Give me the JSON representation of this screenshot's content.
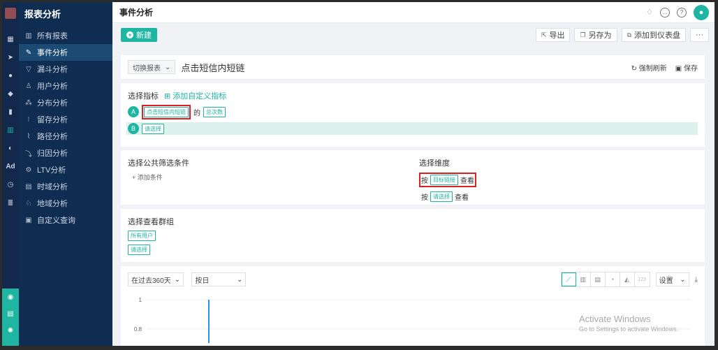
{
  "sidebar": {
    "header": "报表分析",
    "items": [
      {
        "label": "所有报表",
        "icon": "bar-chart-icon",
        "active": false
      },
      {
        "label": "事件分析",
        "icon": "edit-icon",
        "active": true
      },
      {
        "label": "漏斗分析",
        "icon": "funnel-icon",
        "active": false
      },
      {
        "label": "用户分析",
        "icon": "user-icon",
        "active": false
      },
      {
        "label": "分布分析",
        "icon": "distribution-icon",
        "active": false
      },
      {
        "label": "留存分析",
        "icon": "retention-icon",
        "active": false
      },
      {
        "label": "路径分析",
        "icon": "path-icon",
        "active": false
      },
      {
        "label": "归因分析",
        "icon": "attribution-icon",
        "active": false
      },
      {
        "label": "LTV分析",
        "icon": "ltv-icon",
        "active": false
      },
      {
        "label": "时域分析",
        "icon": "time-icon",
        "active": false
      },
      {
        "label": "地域分析",
        "icon": "region-icon",
        "active": false
      },
      {
        "label": "自定义查询",
        "icon": "query-icon",
        "active": false
      }
    ]
  },
  "rail": {
    "ad_label": "Ad"
  },
  "topbar": {
    "title": "事件分析",
    "avatar_icon": "user-icon"
  },
  "actions": {
    "new_label": "新建",
    "export_label": "导出",
    "save_as_label": "另存为",
    "add_dashboard_label": "添加到仪表盘",
    "more_label": "···"
  },
  "report": {
    "switch_label": "切换报表",
    "name": "点击短信内短链",
    "refresh_label": "强制刷新",
    "save_label": "保存"
  },
  "metrics": {
    "title": "选择指标",
    "add_custom_label": "添加自定义指标",
    "rows": [
      {
        "badge": "A",
        "event": "点击短信内短链",
        "joiner": "的",
        "measure": "总次数"
      },
      {
        "badge": "B",
        "event": "请选择"
      }
    ]
  },
  "filters": {
    "title": "选择公共筛选条件",
    "add_condition_label": "+ 添加条件"
  },
  "dimensions": {
    "title": "选择维度",
    "rows": [
      {
        "prefix": "按",
        "value": "目标链接",
        "suffix": "查看"
      },
      {
        "prefix": "按",
        "value": "请选择",
        "suffix": "查看"
      }
    ]
  },
  "groups": {
    "title": "选择查看群组",
    "all_users": "所有用户",
    "select": "请选择"
  },
  "chart_controls": {
    "time_range": "在过去360天",
    "granularity": "按日",
    "settings_label": "设置",
    "count_label": "123"
  },
  "chart_data": {
    "type": "line",
    "x": [],
    "series": [],
    "y_ticks": [
      "1",
      "0.8"
    ],
    "ylim": [
      0,
      1
    ],
    "grid": true
  },
  "watermark": {
    "line1": "Activate Windows",
    "line2": "Go to Settings to activate Windows."
  },
  "colors": {
    "accent": "#1fb5a3",
    "sidebar": "#0f2d50",
    "highlight": "#e02020",
    "line": "#2f8ee8"
  }
}
